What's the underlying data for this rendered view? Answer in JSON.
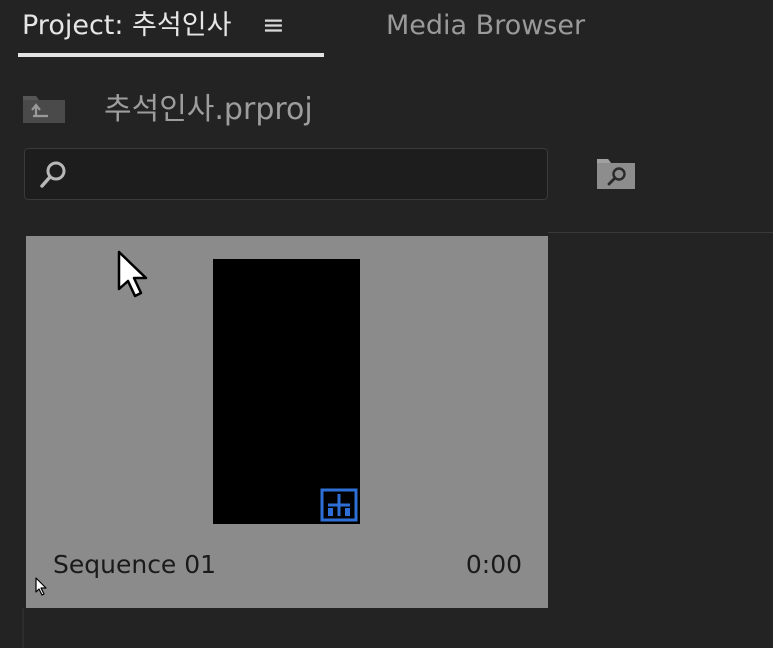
{
  "tabs": {
    "project_label": "Project: 추석인사",
    "media_browser_label": "Media Browser"
  },
  "path": {
    "project_file": "추석인사.prproj"
  },
  "search": {
    "placeholder": "",
    "value": ""
  },
  "items": [
    {
      "name": "Sequence 01",
      "duration": "0:00",
      "type": "sequence"
    }
  ],
  "colors": {
    "panel_bg": "#232323",
    "tile_bg": "#8b8b8b",
    "sequence_icon": "#2d6fd6"
  },
  "icons": [
    "hamburger-menu-icon",
    "folder-up-icon",
    "search-icon",
    "find-in-bin-icon",
    "sequence-icon",
    "mouse-pointer-icon"
  ]
}
